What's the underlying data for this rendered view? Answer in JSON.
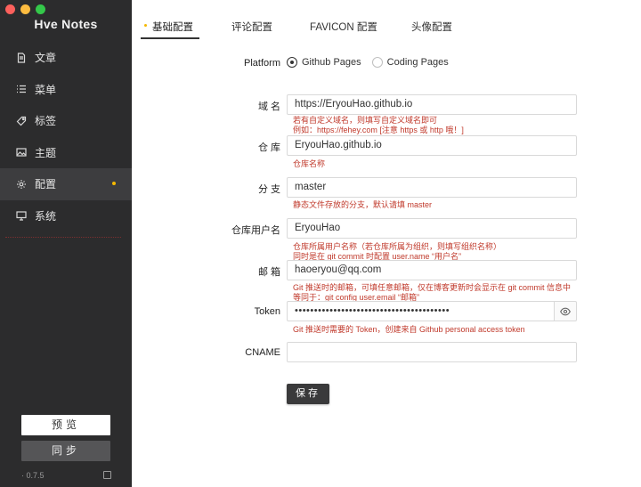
{
  "app": {
    "title": "Hve Notes",
    "version": "· 0.7.5",
    "preview_label": "预览",
    "sync_label": "同步"
  },
  "sidebar": {
    "items": [
      {
        "label": "文章",
        "icon": "document-icon"
      },
      {
        "label": "菜单",
        "icon": "list-icon"
      },
      {
        "label": "标签",
        "icon": "tag-icon"
      },
      {
        "label": "主题",
        "icon": "image-icon"
      },
      {
        "label": "配置",
        "icon": "gear-icon",
        "active": true
      },
      {
        "label": "系统",
        "icon": "monitor-icon"
      }
    ]
  },
  "tabs": [
    {
      "label": "基础配置",
      "active": true
    },
    {
      "label": "评论配置"
    },
    {
      "label": "FAVICON 配置"
    },
    {
      "label": "头像配置"
    }
  ],
  "form": {
    "platform": {
      "label": "Platform",
      "options": [
        "Github Pages",
        "Coding Pages"
      ],
      "selected": "Github Pages"
    },
    "domain": {
      "label": "域 名",
      "value": "https://EryouHao.github.io",
      "hint1": "若有自定义域名，则填写自定义域名即可",
      "hint2": "例如：https://fehey.com [注意 https 或 http 哦！]"
    },
    "repo": {
      "label": "仓 库",
      "value": "EryouHao.github.io",
      "hint1": "仓库名称"
    },
    "branch": {
      "label": "分 支",
      "value": "master",
      "hint1": "静态文件存放的分支，默认请填 master"
    },
    "username": {
      "label": "仓库用户名",
      "value": "EryouHao",
      "hint1": "仓库所属用户名称（若仓库所属为组织，则填写组织名称）",
      "hint2": "同时是在 git commit 时配置 user.name “用户名”"
    },
    "email": {
      "label": "邮 箱",
      "value": "haoeryou@qq.com",
      "hint1": "Git 推送时的邮箱，可填任意邮箱，仅在博客更新时会显示在 git commit 信息中",
      "hint2": "等同于：git config user.email “邮箱”"
    },
    "token": {
      "label": "Token",
      "value": "••••••••••••••••••••••••••••••••••••••••",
      "hint1": "Git 推送时需要的 Token，创建来自 Github personal access token"
    },
    "cname": {
      "label": "CNAME",
      "value": ""
    },
    "save_label": "保存"
  },
  "colors": {
    "sidebar_bg": "#2c2c2d",
    "accent_dot": "#f5b800",
    "hint_red": "#c0392b"
  }
}
